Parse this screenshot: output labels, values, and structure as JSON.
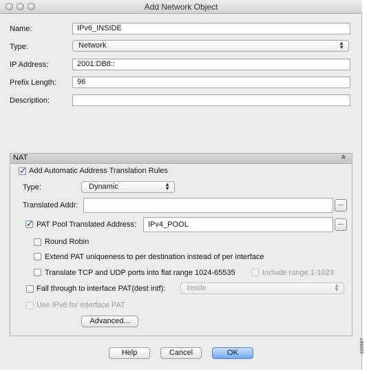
{
  "window": {
    "title": "Add Network Object"
  },
  "form": {
    "name_label": "Name:",
    "name_value": "IPv6_INSIDE",
    "type_label": "Type:",
    "type_value": "Network",
    "ip_label": "IP Address:",
    "ip_value": "2001:DB8::",
    "prefix_label": "Prefix Length:",
    "prefix_value": "96",
    "description_label": "Description:",
    "description_value": ""
  },
  "nat": {
    "header": "NAT",
    "collapse_glyph": "«",
    "auto_rules_label": "Add Automatic Address Translation Rules",
    "auto_rules_checked": true,
    "type_label": "Type:",
    "type_value": "Dynamic",
    "translated_label": "Translated Addr:",
    "translated_value": "",
    "browse_glyph": "...",
    "pat_pool_label": "PAT Pool Translated Address:",
    "pat_pool_checked": true,
    "pat_pool_value": "IPv4_POOL",
    "round_robin_label": "Round Robin",
    "extend_pat_label": "Extend PAT uniqueness to per destination instead of per interface",
    "translate_tcp_label": "Translate TCP and UDP ports into flat range 1024-65535",
    "include_range_label": "Include range 1-1023",
    "fall_through_label": "Fall through to interface PAT(dest intf):",
    "fall_through_value": "inside",
    "use_ipv6_label": "Use IPv6 for interface PAT",
    "advanced_label": "Advanced..."
  },
  "buttons": {
    "help": "Help",
    "cancel": "Cancel",
    "ok": "OK"
  },
  "figure_id": "333987"
}
